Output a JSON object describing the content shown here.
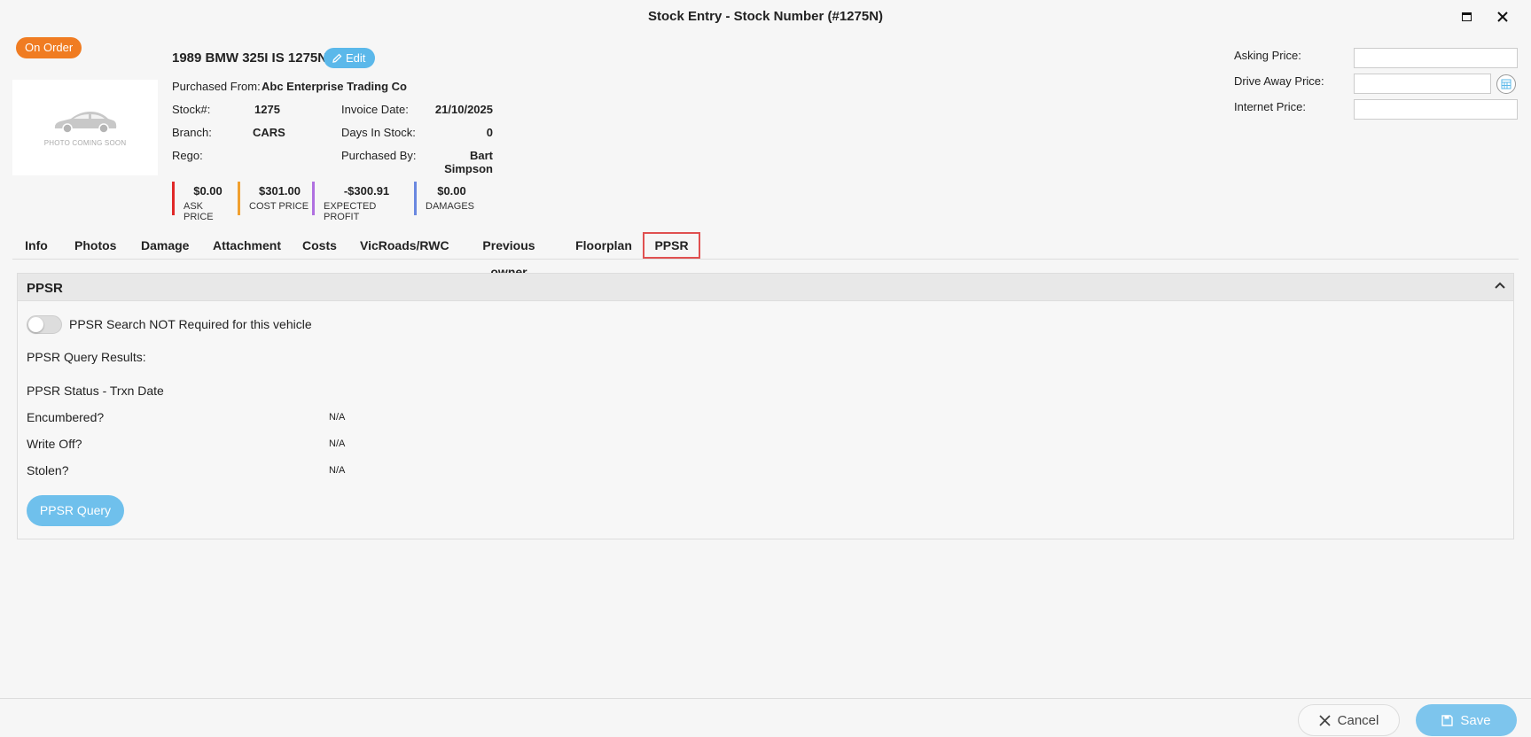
{
  "window": {
    "title": "Stock Entry - Stock Number (#1275N)"
  },
  "status_badge": "On Order",
  "photo": {
    "caption": "PHOTO COMING SOON"
  },
  "vehicle": {
    "title": "1989 BMW 325I IS 1275N",
    "edit_label": "Edit",
    "purchased_from_label": "Purchased From:",
    "purchased_from_value": "Abc Enterprise Trading Co",
    "stock_label": "Stock#:",
    "stock_value": "1275",
    "branch_label": "Branch:",
    "branch_value": "CARS",
    "rego_label": "Rego:",
    "rego_value": "",
    "invoice_date_label": "Invoice Date:",
    "invoice_date_value": "21/10/2025",
    "days_in_stock_label": "Days In Stock:",
    "days_in_stock_value": "0",
    "purchased_by_label": "Purchased By:",
    "purchased_by_value": "Bart Simpson"
  },
  "kpis": [
    {
      "value": "$0.00",
      "label": "ASK PRICE",
      "color": "#e02828"
    },
    {
      "value": "$301.00",
      "label": "COST PRICE",
      "color": "#f0a030"
    },
    {
      "value": "-$300.91",
      "label": "EXPECTED PROFIT",
      "color": "#b070e0"
    },
    {
      "value": "$0.00",
      "label": "DAMAGES",
      "color": "#6a88e0"
    }
  ],
  "prices": {
    "asking_label": "Asking Price:",
    "asking_value": "",
    "drive_away_label": "Drive Away Price:",
    "drive_away_value": "",
    "internet_label": "Internet Price:",
    "internet_value": ""
  },
  "tabs": [
    "Info",
    "Photos",
    "Damage",
    "Attachment",
    "Costs",
    "VicRoads/RWC",
    "Previous owner",
    "Floorplan",
    "PPSR"
  ],
  "active_tab": "PPSR",
  "ppsr": {
    "section_title": "PPSR",
    "toggle_label": "PPSR Search NOT Required for this vehicle",
    "toggle_on": false,
    "query_results_label": "PPSR Query Results:",
    "status_label": "PPSR Status - Trxn Date",
    "encumbered_label": "Encumbered?",
    "encumbered_value": "N/A",
    "write_off_label": "Write Off?",
    "write_off_value": "N/A",
    "stolen_label": "Stolen?",
    "stolen_value": "N/A",
    "query_button": "PPSR Query"
  },
  "footer": {
    "cancel_label": "Cancel",
    "save_label": "Save"
  },
  "colors": {
    "badge": "#f07c22",
    "accent": "#5bb8ea",
    "active_tab_border": "#e05050"
  }
}
